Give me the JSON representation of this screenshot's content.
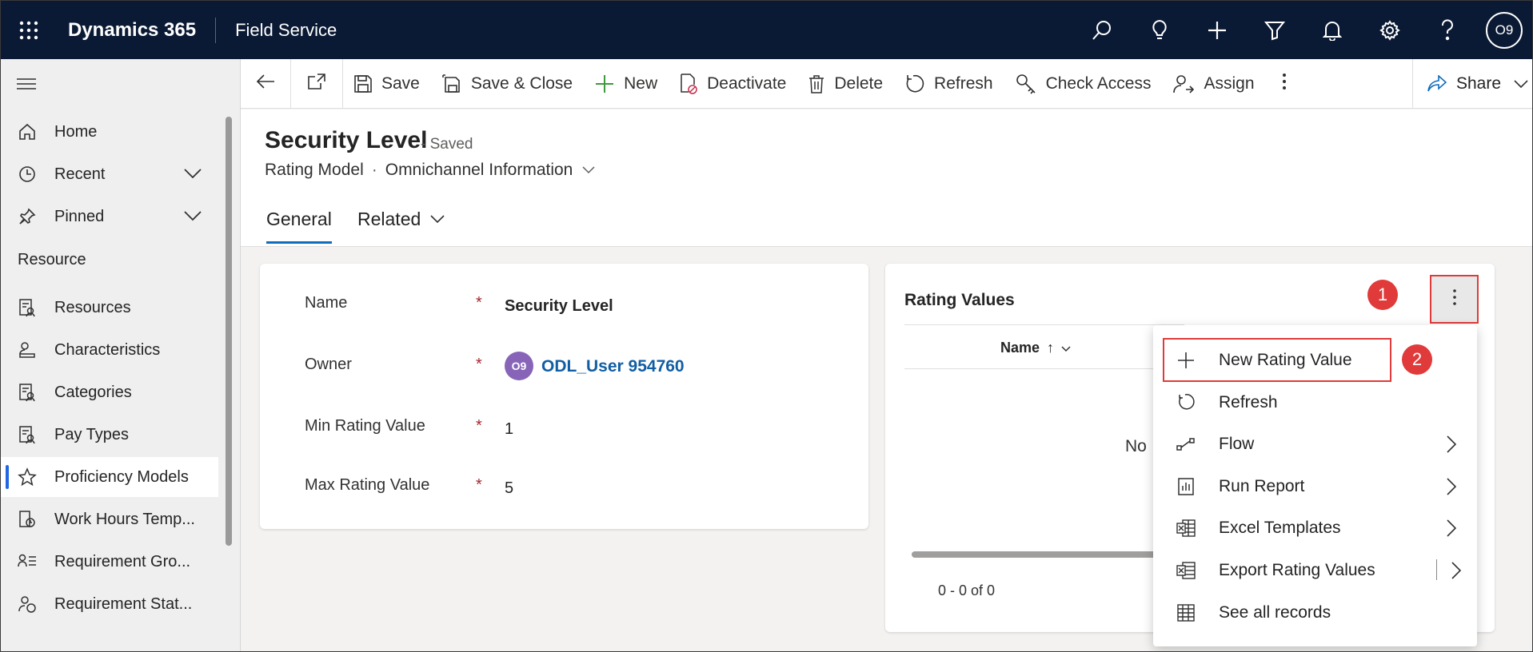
{
  "topbar": {
    "app_name": "Dynamics 365",
    "module_name": "Field Service",
    "icons": [
      "search-icon",
      "lightbulb-icon",
      "plus-icon",
      "filter-icon",
      "bell-icon",
      "gear-icon",
      "help-icon"
    ],
    "user_initials": "O9",
    "background": "#0b1a34"
  },
  "nav": {
    "items_top": [
      {
        "label": "Home",
        "icon": "home-icon"
      },
      {
        "label": "Recent",
        "icon": "clock-icon"
      },
      {
        "label": "Pinned",
        "icon": "pin-icon"
      }
    ],
    "section_title": "Resource",
    "items": [
      {
        "label": "Resources",
        "icon": "resources-icon"
      },
      {
        "label": "Characteristics",
        "icon": "characteristics-icon"
      },
      {
        "label": "Categories",
        "icon": "categories-icon"
      },
      {
        "label": "Pay Types",
        "icon": "pay-types-icon"
      },
      {
        "label": "Proficiency Models",
        "icon": "star-icon",
        "active": true
      },
      {
        "label": "Work Hours Temp...",
        "icon": "work-hours-icon"
      },
      {
        "label": "Requirement Gro...",
        "icon": "requirement-group-icon"
      },
      {
        "label": "Requirement Stat...",
        "icon": "requirement-status-icon"
      }
    ]
  },
  "commands": {
    "save": "Save",
    "save_close": "Save & Close",
    "new": "New",
    "deactivate": "Deactivate",
    "delete": "Delete",
    "refresh": "Refresh",
    "check_access": "Check Access",
    "assign": "Assign",
    "share": "Share"
  },
  "record": {
    "title": "Security Level",
    "status": "- Saved",
    "entity": "Rating Model",
    "separator": "·",
    "form_name": "Omnichannel Information",
    "tabs": {
      "general": "General",
      "related": "Related"
    }
  },
  "form": {
    "fields": [
      {
        "label": "Name",
        "required": "*",
        "value": "Security Level"
      },
      {
        "label": "Owner",
        "required": "*",
        "value": "ODL_User 954760",
        "avatar": "O9"
      },
      {
        "label": "Min Rating Value",
        "required": "*",
        "value": "1"
      },
      {
        "label": "Max Rating Value",
        "required": "*",
        "value": "5"
      }
    ]
  },
  "subgrid": {
    "title": "Rating Values",
    "column_name": "Name",
    "sort_indicator": "↑",
    "empty_text": "No",
    "pager": "0 - 0 of 0",
    "callout_1": "1",
    "callout_2": "2"
  },
  "menu": {
    "items": [
      {
        "label": "New Rating Value",
        "icon": "plus-icon",
        "submenu": false
      },
      {
        "label": "Refresh",
        "icon": "refresh-icon",
        "submenu": false
      },
      {
        "label": "Flow",
        "icon": "flow-icon",
        "submenu": true
      },
      {
        "label": "Run Report",
        "icon": "report-icon",
        "submenu": true
      },
      {
        "label": "Excel Templates",
        "icon": "excel-icon",
        "submenu": true
      },
      {
        "label": "Export Rating Values",
        "icon": "excel-export-icon",
        "submenu": true
      },
      {
        "label": "See all records",
        "icon": "table-icon",
        "submenu": false
      }
    ]
  },
  "colors": {
    "accent": "#0f6cbd",
    "callout": "#e03a3a",
    "link": "#115ea3",
    "required": "#a4262c"
  }
}
